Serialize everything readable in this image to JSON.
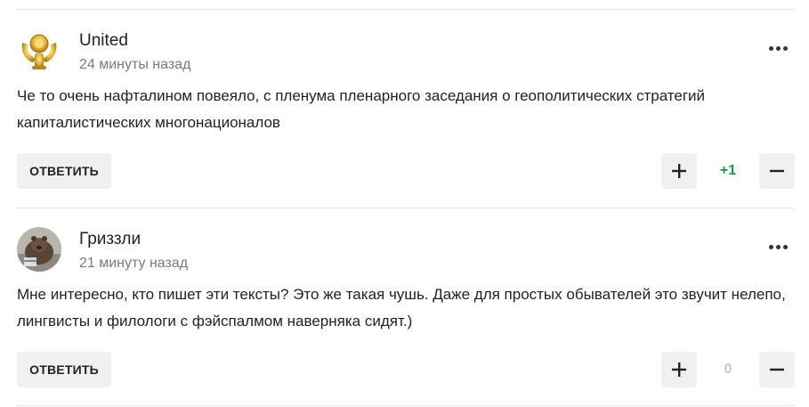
{
  "comments": [
    {
      "author": "United",
      "time": "24 минуты назад",
      "text": "Че то очень нафталином повеяло, с пленума пленарного заседания о геополитических стратегий капиталистических многонационалов",
      "reply_label": "ОТВЕТИТЬ",
      "score": "+1",
      "score_color": "#1a9a4a",
      "avatar_icon": "golden-emblem-avatar"
    },
    {
      "author": "Гриззли",
      "time": "21 минуту назад",
      "text": "Мне интересно, кто пишет эти тексты? Это же такая чушь. Даже для простых обывателей это звучит нелепо, лингвисты и филологи с фэйспалмом наверняка сидят.)",
      "reply_label": "ОТВЕТИТЬ",
      "score": "0",
      "score_color": "#c8c8c8",
      "avatar_icon": "bear-photo-avatar"
    }
  ],
  "colors": {
    "button_bg": "#f0f0f0",
    "divider": "#e6e6e6",
    "meta_text": "#7a7a7a"
  }
}
